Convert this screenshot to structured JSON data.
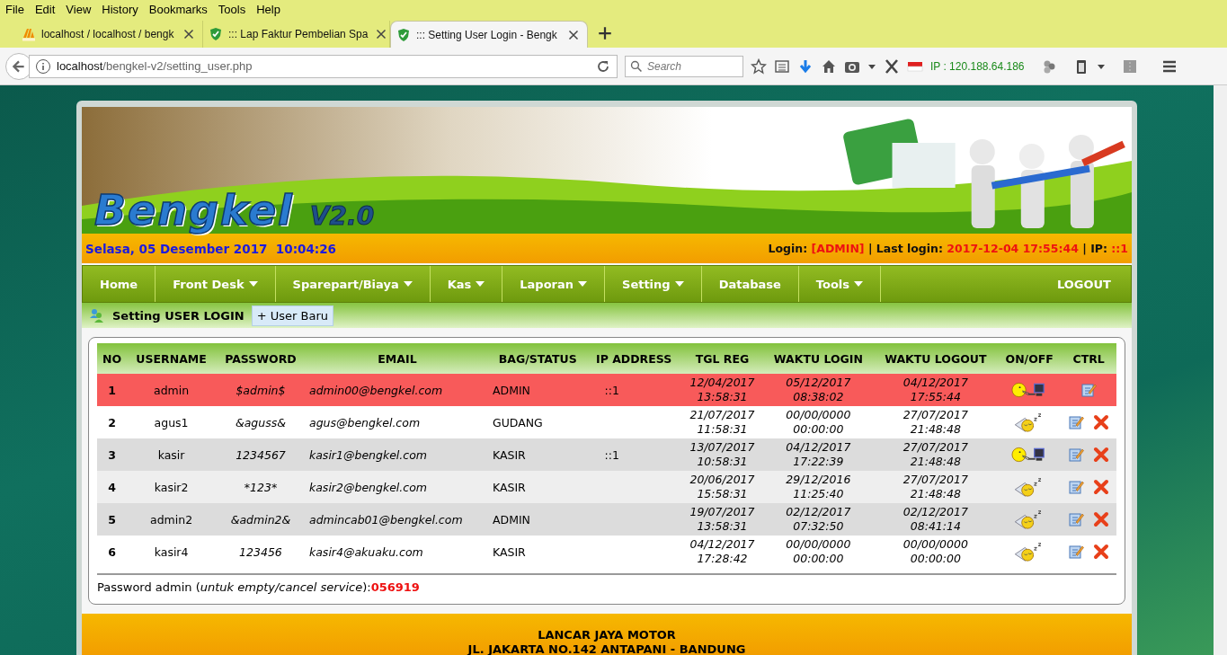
{
  "browser": {
    "menu": [
      "File",
      "Edit",
      "View",
      "History",
      "Bookmarks",
      "Tools",
      "Help"
    ],
    "tabs": [
      {
        "title": "localhost / localhost / bengk",
        "kind": "pma",
        "selected": false
      },
      {
        "title": "::: Lap Faktur Pembelian Spa",
        "kind": "shield",
        "selected": false
      },
      {
        "title": "::: Setting User Login - Bengk",
        "kind": "shield",
        "selected": true
      }
    ],
    "url": {
      "host": "localhost",
      "path": "/bengkel-v2/setting_user.php"
    },
    "search": {
      "placeholder": "Search"
    },
    "ip_label": "IP : 120.188.64.186"
  },
  "page": {
    "logo": {
      "name": "Bengkel",
      "version": "V2.0"
    },
    "date": "Selasa, 05 Desember 2017",
    "time": "10:04:26",
    "login_info": [
      {
        "text": "Login: ",
        "highlight": false
      },
      {
        "text": "[ADMIN]",
        "highlight": true
      },
      {
        "text": " | Last login: ",
        "highlight": false
      },
      {
        "text": "2017-12-04 17:55:44",
        "highlight": true
      },
      {
        "text": " | IP: ",
        "highlight": false
      },
      {
        "text": "::1",
        "highlight": true
      }
    ],
    "nav": [
      {
        "label": "Home",
        "dropdown": false
      },
      {
        "label": "Front Desk",
        "dropdown": true
      },
      {
        "label": "Sparepart/Biaya",
        "dropdown": true
      },
      {
        "label": "Kas",
        "dropdown": true
      },
      {
        "label": "Laporan",
        "dropdown": true
      },
      {
        "label": "Setting",
        "dropdown": true
      },
      {
        "label": "Database",
        "dropdown": false
      },
      {
        "label": "Tools",
        "dropdown": true
      }
    ],
    "logout": "LOGOUT",
    "section_title": "Setting USER LOGIN",
    "new_user_button": "+ User Baru",
    "table": {
      "columns": [
        "NO",
        "USERNAME",
        "PASSWORD",
        "EMAIL",
        "BAG/STATUS",
        "IP ADDRESS",
        "TGL REG",
        "WAKTU LOGIN",
        "WAKTU LOGOUT",
        "ON/OFF",
        "CTRL"
      ],
      "rows": [
        {
          "no": "1",
          "username": "admin",
          "password": "$admin$",
          "email": "admin00@bengkel.com",
          "status": "ADMIN",
          "ip": "::1",
          "reg": "12/04/2017\n13:58:31",
          "login": "05/12/2017\n08:38:02",
          "logout": "04/12/2017\n17:55:44",
          "online": true,
          "current": true,
          "deletable": false
        },
        {
          "no": "2",
          "username": "agus1",
          "password": "&aguss&",
          "email": "agus@bengkel.com",
          "status": "GUDANG",
          "reg": "21/07/2017\n11:58:31",
          "login": "00/00/0000\n00:00:00",
          "logout": "27/07/2017\n21:48:48",
          "online": false,
          "current": false,
          "deletable": true
        },
        {
          "no": "3",
          "username": "kasir",
          "password": "1234567",
          "email": "kasir1@bengkel.com",
          "status": "KASIR",
          "ip": "::1",
          "reg": "13/07/2017\n10:58:31",
          "login": "04/12/2017\n17:22:39",
          "logout": "27/07/2017\n21:48:48",
          "online": true,
          "current": false,
          "deletable": true
        },
        {
          "no": "4",
          "username": "kasir2",
          "password": "*123*",
          "email": "kasir2@bengkel.com",
          "status": "KASIR",
          "reg": "20/06/2017\n15:58:31",
          "login": "29/12/2016\n11:25:40",
          "logout": "27/07/2017\n21:48:48",
          "online": false,
          "current": false,
          "deletable": true
        },
        {
          "no": "5",
          "username": "admin2",
          "password": "&admin2&",
          "email": "admincab01@bengkel.com",
          "status": "ADMIN",
          "reg": "19/07/2017\n13:58:31",
          "login": "02/12/2017\n07:32:50",
          "logout": "02/12/2017\n08:41:14",
          "online": false,
          "current": false,
          "deletable": true
        },
        {
          "no": "6",
          "username": "kasir4",
          "password": "123456",
          "email": "kasir4@akuaku.com",
          "status": "KASIR",
          "reg": "04/12/2017\n17:28:42",
          "login": "00/00/0000\n00:00:00",
          "logout": "00/00/0000\n00:00:00",
          "online": false,
          "current": false,
          "deletable": true
        }
      ]
    },
    "note": "Password admin (*untuk empty/cancel service*): ",
    "admin_code": "056919",
    "footer": [
      "LANCAR JAYA MOTOR",
      "JL. JAKARTA NO.142 ANTAPANI - BANDUNG"
    ]
  }
}
